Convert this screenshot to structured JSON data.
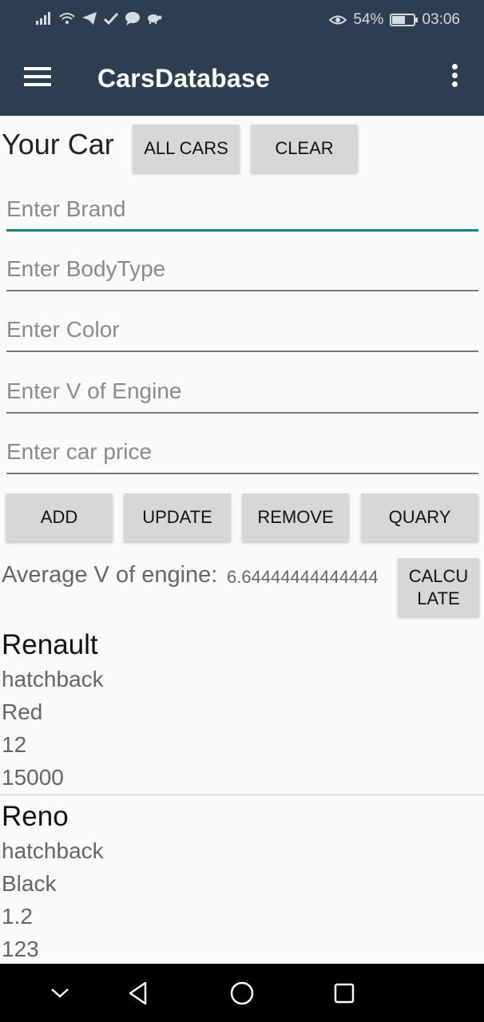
{
  "status_bar": {
    "icons": [
      "signal-icon",
      "wifi-icon",
      "telegram-icon",
      "check-icon",
      "chat-bubble-icon",
      "turtle-icon",
      "eye-icon",
      "battery-icon"
    ],
    "battery_percent": "54%",
    "battery_level": 0.54,
    "time": "03:06"
  },
  "app_bar": {
    "title": "CarsDatabase",
    "background_color": "#2c3e50"
  },
  "top_row": {
    "label": "Your Car",
    "all_cars_button": "ALL CARS",
    "clear_button": "CLEAR"
  },
  "form": {
    "brand_placeholder": "Enter Brand",
    "body_type_placeholder": "Enter BodyType",
    "color_placeholder": "Enter Color",
    "engine_placeholder": "Enter V of Engine",
    "price_placeholder": "Enter car price",
    "focused_field": "brand",
    "accent_color": "#16838a"
  },
  "actions": {
    "add": "ADD",
    "update": "UPDATE",
    "remove": "REMOVE",
    "quary": "QUARY"
  },
  "average": {
    "label": "Average V of engine:",
    "value": "6.64444444444444",
    "calculate_line1": "CALCU",
    "calculate_line2": "LATE"
  },
  "cars": [
    {
      "brand": "Renault",
      "body_type": "hatchback",
      "color": "Red",
      "engine": "12",
      "price": "15000"
    },
    {
      "brand": "Reno",
      "body_type": "hatchback",
      "color": "Black",
      "engine": "1.2",
      "price": "123"
    }
  ]
}
